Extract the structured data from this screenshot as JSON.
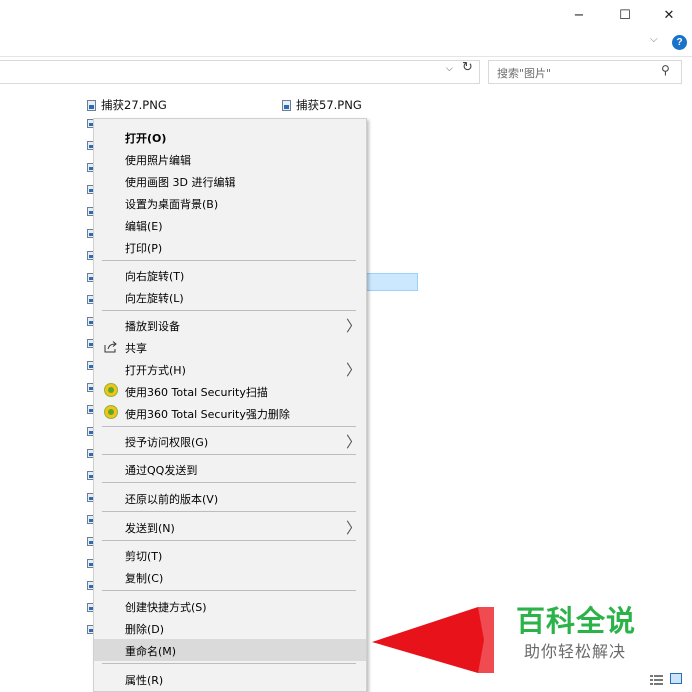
{
  "window": {
    "minimize_glyph": "−",
    "maximize_glyph": "☐",
    "close_glyph": "✕"
  },
  "ribbon": {
    "expand_glyph": "⌵",
    "help_glyph": "?"
  },
  "address": {
    "dropdown_glyph": "⌵",
    "refresh_glyph": "↻"
  },
  "search": {
    "placeholder": "搜索\"图片\"",
    "icon_glyph": "⚲"
  },
  "files": [
    {
      "name": "捕获27.PNG"
    },
    {
      "name": "捕获57.PNG"
    }
  ],
  "context_menu": {
    "items": [
      {
        "label": "打开(O)"
      },
      {
        "label": "使用照片编辑"
      },
      {
        "label": "使用画图 3D 进行编辑"
      },
      {
        "label": "设置为桌面背景(B)"
      },
      {
        "label": "编辑(E)"
      },
      {
        "label": "打印(P)"
      },
      {
        "label": "向右旋转(T)"
      },
      {
        "label": "向左旋转(L)"
      },
      {
        "label": "播放到设备"
      },
      {
        "label": "共享"
      },
      {
        "label": "打开方式(H)"
      },
      {
        "label": "使用360 Total Security扫描"
      },
      {
        "label": "使用360 Total Security强力删除"
      },
      {
        "label": "授予访问权限(G)"
      },
      {
        "label": "通过QQ发送到"
      },
      {
        "label": "还原以前的版本(V)"
      },
      {
        "label": "发送到(N)"
      },
      {
        "label": "剪切(T)"
      },
      {
        "label": "复制(C)"
      },
      {
        "label": "创建快捷方式(S)"
      },
      {
        "label": "删除(D)"
      },
      {
        "label": "重命名(M)"
      },
      {
        "label": "属性(R)"
      }
    ],
    "submenu_glyph": "〉"
  },
  "watermark": {
    "title": "百科全说",
    "subtitle": "助你轻松解决"
  },
  "colors": {
    "menu_bg": "#f2f2f2",
    "hover_bg": "#dadada",
    "arrow": "#e8121a",
    "watermark_green": "#2bb34a"
  }
}
